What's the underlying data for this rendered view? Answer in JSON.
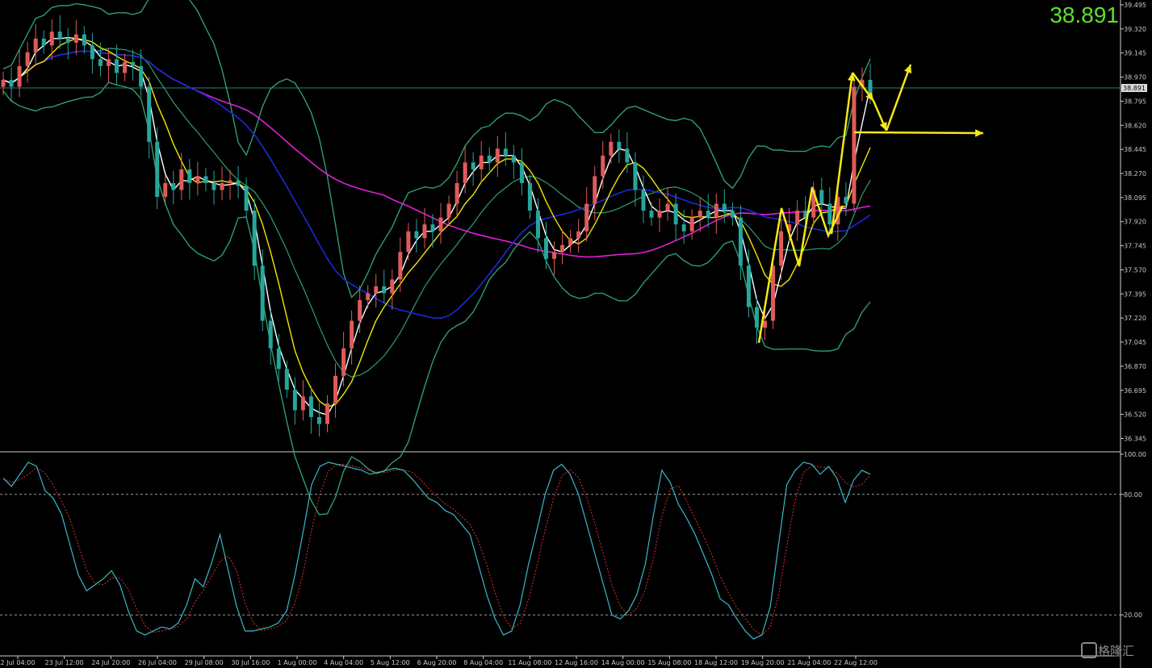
{
  "price_display": "38.891",
  "watermark": "格隆汇",
  "colors": {
    "background": "#000000",
    "up_candle": "#e05a5a",
    "down_candle": "#26a69a",
    "bollinger": "#2e9e6e",
    "ma_fast": "#ffffff",
    "ma_mid": "#f3e600",
    "ma_slow_blue": "#1a2bd6",
    "ma_slow_magenta": "#e020d8",
    "stoch_main": "#3cb8c8",
    "stoch_signal": "#e03030",
    "annotation_arrows": "#f5e81a",
    "current_price_line": "#2a8080",
    "price_big": "#5de12c"
  },
  "chart_data": [
    {
      "type": "candlestick",
      "instrument_hint": "price chart with Bollinger Bands and moving averages",
      "current_price": 38.891,
      "current_price_label": "38.891",
      "ylim": [
        36.26,
        39.53
      ],
      "y_ticks": [
        "39.495",
        "39.320",
        "39.145",
        "38.970",
        "38.795",
        "38.620",
        "38.445",
        "38.270",
        "38.095",
        "37.920",
        "37.745",
        "37.570",
        "37.395",
        "37.220",
        "37.045",
        "36.870",
        "36.695",
        "36.520",
        "36.345"
      ],
      "x_ticks": [
        "2 Jul 04:00",
        "23 Jul 12:00",
        "24 Jul 20:00",
        "26 Jul 04:00",
        "29 Jul 08:00",
        "30 Jul 16:00",
        "1 Aug 00:00",
        "4 Aug 04:00",
        "5 Aug 12:00",
        "6 Aug 20:00",
        "8 Aug 04:00",
        "11 Aug 08:00",
        "12 Aug 16:00",
        "14 Aug 00:00",
        "15 Aug 08:00",
        "18 Aug 12:00",
        "19 Aug 20:00",
        "21 Aug 04:00",
        "22 Aug 12:00"
      ],
      "close_path": [
        38.95,
        38.9,
        39.05,
        39.15,
        39.25,
        39.2,
        39.3,
        39.25,
        39.22,
        39.28,
        39.2,
        39.1,
        39.05,
        39.1,
        39.0,
        39.08,
        39.05,
        38.9,
        38.5,
        38.1,
        38.2,
        38.15,
        38.3,
        38.2,
        38.25,
        38.2,
        38.15,
        38.2,
        38.22,
        38.18,
        38.0,
        37.6,
        37.2,
        37.0,
        36.85,
        36.7,
        36.55,
        36.65,
        36.5,
        36.45,
        36.6,
        36.8,
        37.0,
        37.2,
        37.35,
        37.4,
        37.45,
        37.4,
        37.5,
        37.7,
        37.85,
        37.8,
        37.9,
        37.85,
        37.95,
        38.05,
        38.2,
        38.35,
        38.3,
        38.4,
        38.35,
        38.45,
        38.4,
        38.35,
        38.2,
        38.0,
        37.8,
        37.65,
        37.7,
        37.75,
        37.8,
        37.85,
        38.05,
        38.25,
        38.4,
        38.5,
        38.45,
        38.35,
        38.15,
        38.0,
        37.95,
        38.0,
        38.05,
        37.9,
        37.85,
        37.95,
        38.0,
        37.95,
        38.05,
        38.0,
        37.95,
        37.6,
        37.3,
        37.15,
        37.2,
        37.6,
        37.85,
        37.9,
        38.0,
        37.95,
        38.15,
        38.05,
        37.9,
        38.1,
        38.05,
        38.9,
        38.95,
        38.85
      ]
    },
    {
      "type": "line",
      "name": "stochastic_oscillator",
      "ylim": [
        0,
        100
      ],
      "y_ticks": [
        "100.00",
        "80.00",
        "20.00"
      ],
      "levels": [
        80,
        20
      ],
      "main_line": [
        88,
        84,
        90,
        96,
        94,
        82,
        78,
        70,
        55,
        40,
        32,
        35,
        38,
        42,
        35,
        22,
        12,
        10,
        12,
        14,
        13,
        16,
        25,
        38,
        34,
        46,
        60,
        42,
        24,
        12,
        12,
        13,
        14,
        16,
        22,
        40,
        62,
        85,
        94,
        96,
        95,
        94,
        93,
        92,
        90,
        91,
        92,
        93,
        92,
        88,
        83,
        78,
        76,
        72,
        70,
        65,
        60,
        45,
        30,
        18,
        10,
        12,
        25,
        45,
        62,
        80,
        92,
        95,
        90,
        80,
        65,
        50,
        35,
        20,
        18,
        22,
        30,
        45,
        70,
        92,
        86,
        75,
        68,
        60,
        50,
        40,
        28,
        25,
        18,
        12,
        8,
        10,
        24,
        55,
        85,
        92,
        96,
        95,
        90,
        94,
        88,
        76,
        87,
        92,
        90
      ]
    }
  ],
  "annotations": {
    "note": "hand-drawn yellow arrows"
  }
}
